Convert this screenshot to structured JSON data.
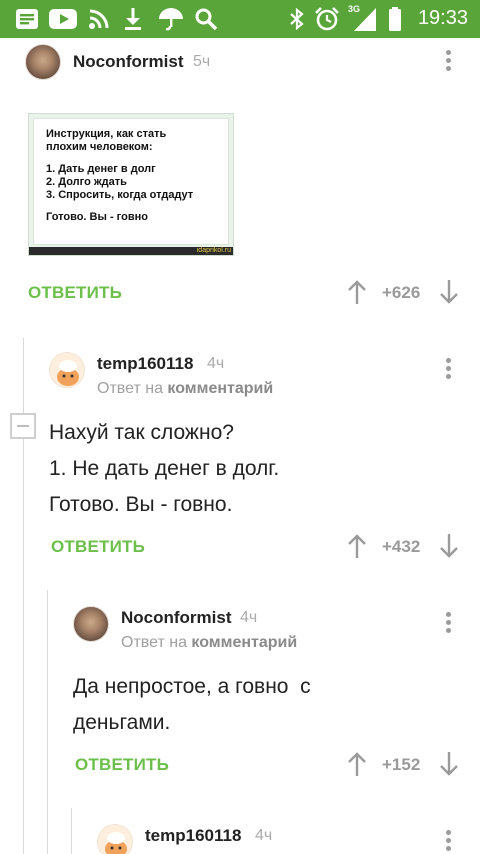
{
  "status_bar": {
    "time": "19:33",
    "network": "3G",
    "icons": [
      "notes-icon",
      "youtube-icon",
      "rss-icon",
      "download-icon",
      "umbrella-icon",
      "search-icon",
      "bluetooth-icon",
      "alarm-icon",
      "signal-icon",
      "battery-icon"
    ]
  },
  "comments": [
    {
      "author": "Noconformist",
      "time": "5ч",
      "image_text": {
        "heading_line1": "Инструкция, как стать",
        "heading_line2": "плохим человеком:",
        "step1": "1. Дать денег в долг",
        "step2": "2. Долго ждать",
        "step3": "3. Спросить, когда отдадут",
        "final": "Готово. Вы - говно",
        "watermark": "idaprikol.ru"
      },
      "reply_label": "ОТВЕТИТЬ",
      "score": "+626"
    },
    {
      "author": "temp160118",
      "time": "4ч",
      "reply_prefix": "Ответ на",
      "reply_target": "комментарий",
      "text_line1": "Нахуй так сложно?",
      "text_line2": "1. Не дать денег в долг.",
      "text_line3": "Готово. Вы - говно.",
      "reply_label": "ОТВЕТИТЬ",
      "score": "+432"
    },
    {
      "author": "Noconformist",
      "time": "4ч",
      "reply_prefix": "Ответ на",
      "reply_target": "комментарий",
      "text_line1": "Да непростое, а говно  с",
      "text_line2": "деньгами.",
      "reply_label": "ОТВЕТИТЬ",
      "score": "+152"
    },
    {
      "author": "temp160118",
      "time": "4ч"
    }
  ]
}
